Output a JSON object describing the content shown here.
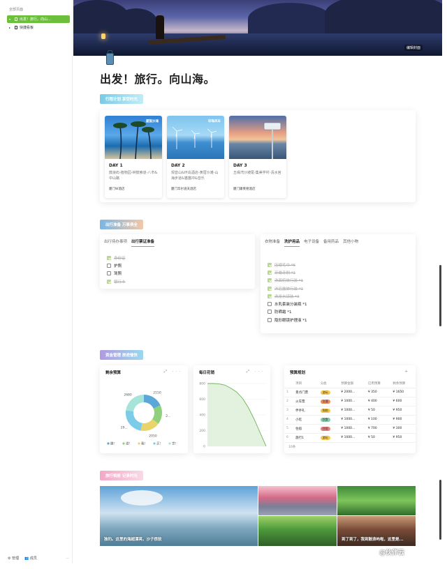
{
  "sidebar": {
    "header": "全部页面",
    "items": [
      {
        "label": "出发！旅行。向山..."
      },
      {
        "label": "快捷看板"
      }
    ],
    "footer": {
      "manage": "管理",
      "members": "成员",
      "more": "···"
    }
  },
  "cover": {
    "button": "编辑封面"
  },
  "page": {
    "title": "出发！旅行。向山海。"
  },
  "sections": {
    "itinerary": "行程计划 享受时光",
    "prep": "出行准备 万事俱全",
    "budget": "资金管理 旅途愉快",
    "memories": "旅行相册 记录时光"
  },
  "days": [
    {
      "tag": "厦鼓沙滩",
      "title": "DAY 1",
      "desc": "鼓浪屿-植物园-钟鼓索道-八市&中山路",
      "hotel": "厦门W酒店"
    },
    {
      "tag": "珍珠风车",
      "title": "DAY 2",
      "desc": "观音山&环岛酒店-黄厝沙滩-山海步道&猫猫冲&音乐",
      "hotel": "厦门华尔道夫酒店"
    },
    {
      "tag": "",
      "title": "DAY 3",
      "desc": "五缘湾沙坡尾-集美学村-清水宫",
      "hotel": "厦门康莱德酒店"
    }
  ],
  "prep": {
    "left_tabs": [
      "出行待办事项",
      "出行票证准备"
    ],
    "left_items": [
      {
        "text": "身份证",
        "done": true
      },
      {
        "text": "护照",
        "done": false
      },
      {
        "text": "驾照",
        "done": false
      },
      {
        "text": "银行卡",
        "done": true
      }
    ],
    "right_tabs": [
      "衣物准备",
      "洗护用品",
      "电子设备",
      "备用药品",
      "其他小物"
    ],
    "right_items": [
      {
        "text": "压缩毛巾 *6",
        "done": true
      },
      {
        "text": "牙膏牙刷 *1",
        "done": true
      },
      {
        "text": "洗面奶旅行装 *1",
        "done": true
      },
      {
        "text": "沐浴露旅行装 *1",
        "done": true
      },
      {
        "text": "洗发水袋装 *3",
        "done": true
      },
      {
        "text": "水乳套装分装瓶 *1",
        "done": false
      },
      {
        "text": "防晒霜 *1",
        "done": false
      },
      {
        "text": "隐形眼镜护理液 *1",
        "done": false
      }
    ]
  },
  "budget": {
    "donut_title": "剩余预算",
    "line_title": "每日花销",
    "table_title": "预算规划",
    "add": "+",
    "donut_labels": [
      "2150",
      "2...",
      "2050",
      "29...",
      "2680"
    ],
    "legend": [
      "膳!",
      "道!",
      "我!",
      "买!",
      "世!"
    ],
    "line_y": [
      "800",
      "600",
      "400",
      "200",
      "0"
    ],
    "columns": [
      "",
      "项目",
      "分类",
      "预算金额",
      "已用预算",
      "剩余预算"
    ],
    "rows": [
      [
        "1",
        "景点门票",
        "游玩",
        "¥ 2000...",
        "¥ 350",
        "¥ 1650"
      ],
      [
        "2",
        "火车票",
        "交通",
        "¥ 1000...",
        "¥ 400",
        "¥ 600"
      ],
      [
        "3",
        "伴手礼",
        "购物",
        "¥ 1000...",
        "¥ 50",
        "¥ 950"
      ],
      [
        "4",
        "小吃",
        "饮食",
        "¥ 1000...",
        "¥ 100",
        "¥ 900"
      ],
      [
        "5",
        "住宿",
        "住宿",
        "¥ 1000...",
        "¥ 700",
        "¥ 300"
      ],
      [
        "6",
        "旅行1",
        "游玩",
        "¥ 1000...",
        "¥ 50",
        "¥ 950"
      ]
    ],
    "footer": "10条"
  },
  "chart_data": [
    {
      "type": "pie",
      "title": "剩余预算",
      "categories": [
        "膳!",
        "道!",
        "我!",
        "买!",
        "世!"
      ],
      "values": [
        2150,
        2000,
        2050,
        2900,
        2680
      ]
    },
    {
      "type": "line",
      "title": "每日花销",
      "x": [
        0,
        1,
        2,
        3,
        4,
        5,
        6,
        7,
        8,
        9,
        10
      ],
      "values": [
        800,
        800,
        795,
        780,
        740,
        690,
        610,
        490,
        340,
        170,
        0
      ],
      "ylim": [
        0,
        800
      ]
    }
  ],
  "photos": {
    "cap1": "独钓。这里的海超漂亮，沙子很软",
    "cap2": "到了到了，我到鼓浪屿啦，这里是..."
  },
  "watermark": "@伙伴云"
}
